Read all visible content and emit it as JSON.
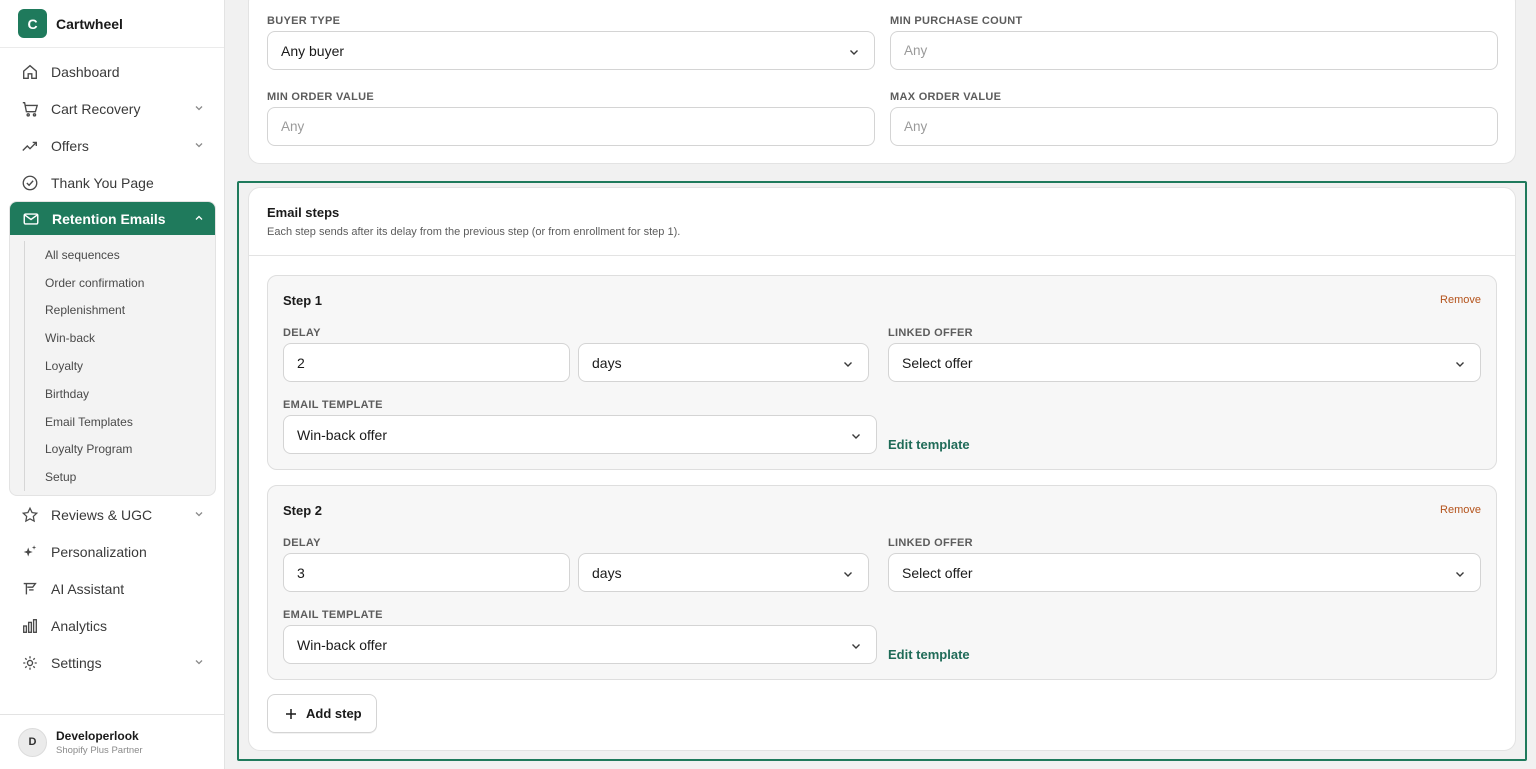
{
  "brand": {
    "initial": "C",
    "name": "Cartwheel"
  },
  "nav": {
    "items": [
      {
        "label": "Dashboard",
        "icon": "home-icon",
        "has_chevron": false
      },
      {
        "label": "Cart Recovery",
        "icon": "cart-icon",
        "has_chevron": true
      },
      {
        "label": "Offers",
        "icon": "trend-icon",
        "has_chevron": true
      },
      {
        "label": "Thank You Page",
        "icon": "check-circle-icon",
        "has_chevron": false
      }
    ],
    "active": {
      "label": "Retention Emails",
      "icon": "mail-icon"
    },
    "subitems": [
      "All sequences",
      "Order confirmation",
      "Replenishment",
      "Win-back",
      "Loyalty",
      "Birthday",
      "Email Templates",
      "Loyalty Program",
      "Setup"
    ],
    "items_after": [
      {
        "label": "Reviews & UGC",
        "icon": "star-icon",
        "has_chevron": true
      },
      {
        "label": "Personalization",
        "icon": "sparkle-icon",
        "has_chevron": false
      },
      {
        "label": "AI Assistant",
        "icon": "ai-icon",
        "has_chevron": false
      },
      {
        "label": "Analytics",
        "icon": "bar-chart-icon",
        "has_chevron": false
      },
      {
        "label": "Settings",
        "icon": "gear-icon",
        "has_chevron": true
      }
    ]
  },
  "user": {
    "initial": "D",
    "name": "Developerlook",
    "role": "Shopify Plus Partner"
  },
  "filters": {
    "buyer_type_label": "BUYER TYPE",
    "buyer_type_value": "Any buyer",
    "min_purchase_label": "MIN PURCHASE COUNT",
    "min_purchase_placeholder": "Any",
    "min_order_label": "MIN ORDER VALUE",
    "min_order_placeholder": "Any",
    "max_order_label": "MAX ORDER VALUE",
    "max_order_placeholder": "Any"
  },
  "email_steps": {
    "title": "Email steps",
    "description": "Each step sends after its delay from the previous step (or from enrollment for step 1).",
    "steps": [
      {
        "title": "Step 1",
        "remove": "Remove",
        "delay_label": "DELAY",
        "delay_value": "2",
        "unit": "days",
        "offer_label": "LINKED OFFER",
        "offer_value": "Select offer",
        "template_label": "EMAIL TEMPLATE",
        "template_value": "Win-back offer",
        "edit": "Edit template"
      },
      {
        "title": "Step 2",
        "remove": "Remove",
        "delay_label": "DELAY",
        "delay_value": "3",
        "unit": "days",
        "offer_label": "LINKED OFFER",
        "offer_value": "Select offer",
        "template_label": "EMAIL TEMPLATE",
        "template_value": "Win-back offer",
        "edit": "Edit template"
      }
    ],
    "add_step": "Add step"
  },
  "colors": {
    "accent": "#1f7a5c",
    "remove": "#b4531b",
    "edit_link": "#1f6b58"
  }
}
